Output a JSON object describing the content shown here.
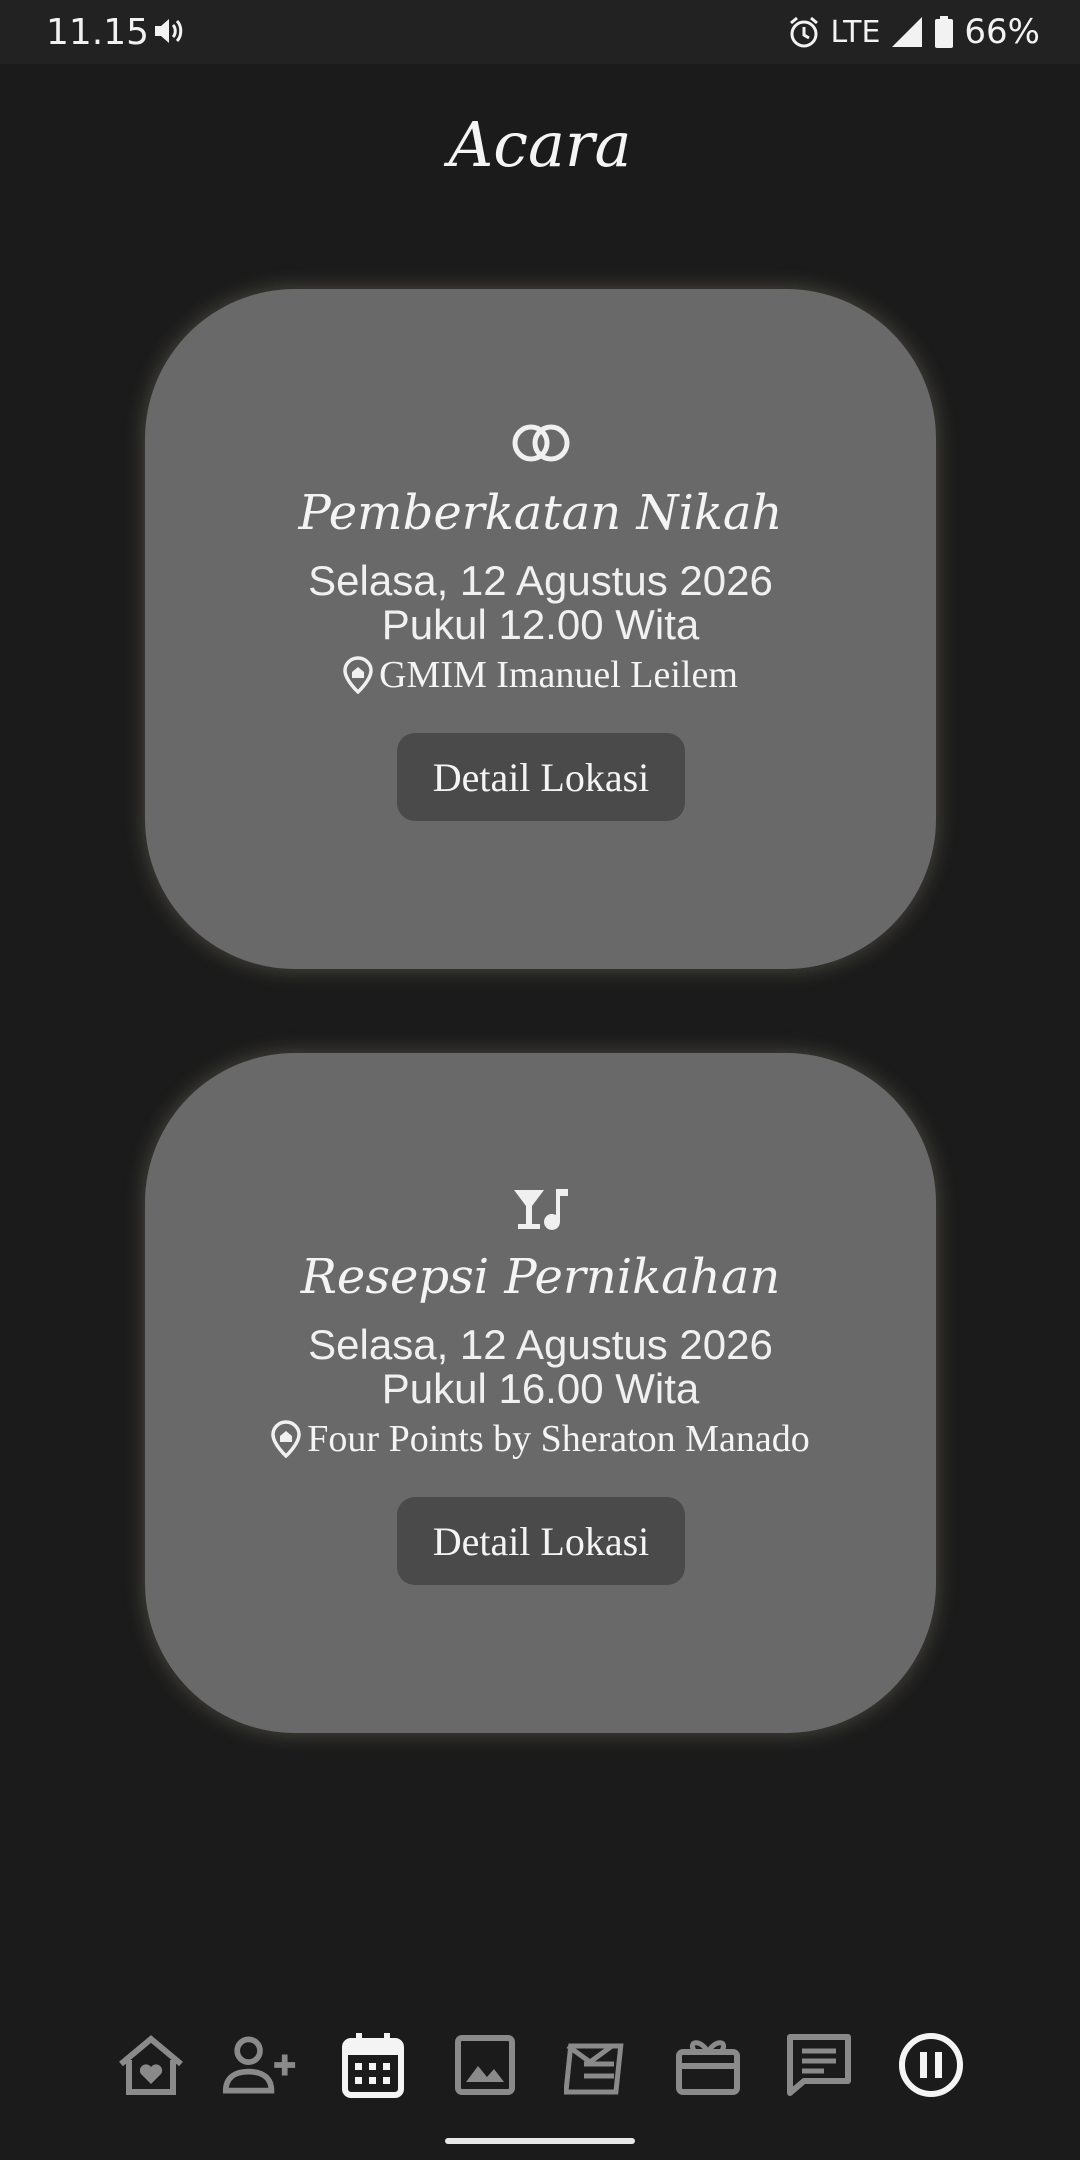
{
  "status_bar": {
    "time": "11.15",
    "network": "LTE",
    "battery": "66%"
  },
  "page": {
    "title": "Acara"
  },
  "events": [
    {
      "icon": "rings-icon",
      "title": "Pemberkatan Nikah",
      "date": "Selasa, 12 Agustus 2026",
      "time": "Pukul 12.00 Wita",
      "location": "GMIM Imanuel Leilem",
      "button_label": "Detail Lokasi"
    },
    {
      "icon": "cocktail-music-icon",
      "title": "Resepsi Pernikahan",
      "date": "Selasa, 12 Agustus 2026",
      "time": "Pukul 16.00 Wita",
      "location": "Four Points by Sheraton Manado",
      "button_label": "Detail Lokasi"
    }
  ],
  "bottom_nav": {
    "items": [
      "home-heart-icon",
      "add-guest-icon",
      "calendar-icon",
      "gallery-icon",
      "gift-card-icon",
      "gift-icon",
      "chat-icon",
      "pause-icon"
    ],
    "active": "calendar-icon"
  },
  "colors": {
    "background": "#1b1b1b",
    "card": "#696969",
    "button": "#4a4a4a"
  }
}
